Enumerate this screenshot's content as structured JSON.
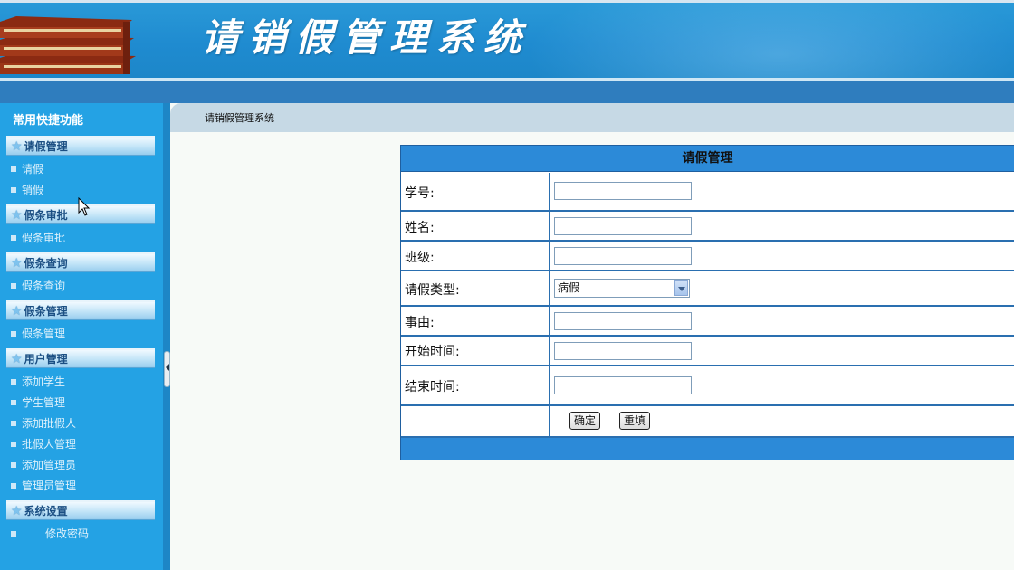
{
  "header": {
    "title": "请销假管理系统"
  },
  "sidebar": {
    "title": "常用快捷功能",
    "sections": [
      {
        "label": "请假管理",
        "items": [
          "请假",
          "销假"
        ]
      },
      {
        "label": "假条审批",
        "items": [
          "假条审批"
        ]
      },
      {
        "label": "假条查询",
        "items": [
          "假条查询"
        ]
      },
      {
        "label": "假条管理",
        "items": [
          "假条管理"
        ]
      },
      {
        "label": "用户管理",
        "items": [
          "添加学生",
          "学生管理",
          "添加批假人",
          "批假人管理",
          "添加管理员",
          "管理员管理"
        ]
      },
      {
        "label": "系统设置",
        "items": [
          "修改密码"
        ]
      }
    ]
  },
  "breadcrumb": "请销假管理系统",
  "form": {
    "title": "请假管理",
    "student_id_label": "学号:",
    "name_label": "姓名:",
    "class_label": "班级:",
    "leave_type_label": "请假类型:",
    "leave_type_value": "病假",
    "reason_label": "事由:",
    "start_label": "开始时间:",
    "end_label": "结束时间:",
    "confirm_label": "确定",
    "reset_label": "重填"
  }
}
